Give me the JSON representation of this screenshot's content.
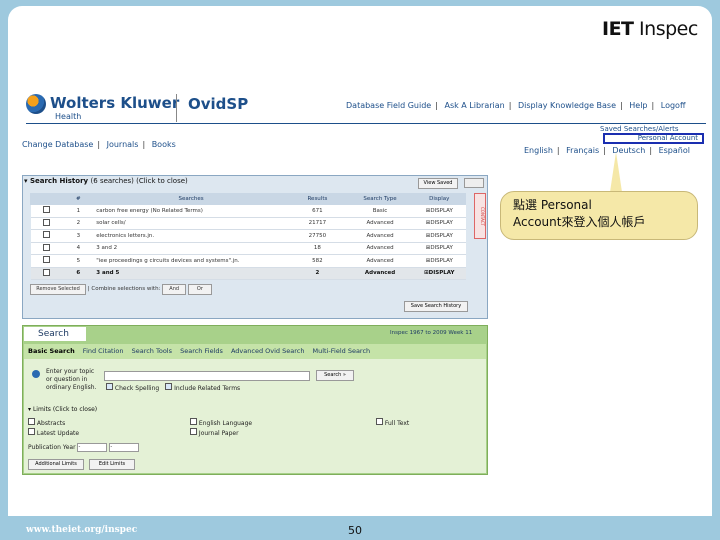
{
  "brand": {
    "iet_logo_bold": "IET",
    "iet_logo_thin": " Inspec",
    "wk_logo": "Wolters Kluwer",
    "wk_sub": "Health",
    "ovid": "OvidSP"
  },
  "top_links": [
    "Database Field Guide",
    "Ask A Librarian",
    "Display Knowledge Base",
    "Help",
    "Logoff"
  ],
  "nav_links": [
    "Change Database",
    "Journals",
    "Books"
  ],
  "saved_searches": "Saved Searches/Alerts",
  "personal_account": "Personal Account",
  "languages": [
    "English",
    "Français",
    "Deutsch",
    "Español"
  ],
  "history": {
    "title": "Search History",
    "count_note": "(6 searches) (Click to close)",
    "view_saved": "View Saved",
    "columns": [
      "#",
      "Searches",
      "Results",
      "Search Type",
      "Display"
    ],
    "rows": [
      {
        "num": "1",
        "search": "carbon free energy (No Related Terms)",
        "results": "671",
        "type": "Basic",
        "display": "DISPLAY"
      },
      {
        "num": "2",
        "search": "solar cells/",
        "results": "21717",
        "type": "Advanced",
        "display": "DISPLAY"
      },
      {
        "num": "3",
        "search": "electronics letters.jn.",
        "results": "27750",
        "type": "Advanced",
        "display": "DISPLAY"
      },
      {
        "num": "4",
        "search": "3 and 2",
        "results": "18",
        "type": "Advanced",
        "display": "DISPLAY"
      },
      {
        "num": "5",
        "search": "\"iee proceedings g circuits devices and systems\".jn.",
        "results": "582",
        "type": "Advanced",
        "display": "DISPLAY"
      },
      {
        "num": "6",
        "search": "3 and 5",
        "results": "2",
        "type": "Advanced",
        "display": "DISPLAY"
      }
    ],
    "remove_selected": "Remove Selected",
    "combine_label": "Combine selections with:",
    "and_btn": "And",
    "or_btn": "Or",
    "save_history": "Save Search History",
    "side_label": "CONTACT"
  },
  "search": {
    "tab_label": "Search",
    "coverage": "Inspec 1967 to 2009 Week 11",
    "tabs": [
      "Basic Search",
      "Find Citation",
      "Search Tools",
      "Search Fields",
      "Advanced Ovid Search",
      "Multi-Field Search"
    ],
    "enter_topic": [
      "Enter your topic",
      "or question in",
      "ordinary English."
    ],
    "search_btn": "Search »",
    "check_spelling": "Check Spelling",
    "include_related": "Include Related Terms",
    "limits_head": "Limits (Click to close)",
    "limits": [
      "Abstracts",
      "English Language",
      "Full Text",
      "Latest Update",
      "Journal Paper"
    ],
    "pub_year_label": "Publication Year",
    "pub_from": "-",
    "pub_to": "-",
    "additional_limits": "Additional Limits",
    "edit_limits": "Edit Limits"
  },
  "callout": {
    "line1": "點選 Personal",
    "line2": "Account來登入個人帳戶"
  },
  "footer": {
    "url": "www.theiet.org/inspec",
    "page": "50"
  },
  "colors": {
    "accent_blue": "#1d4f8a",
    "highlight_box": "#1a2eb0",
    "search_green": "#a8d18a",
    "callout_yellow": "#f5e8a8"
  }
}
